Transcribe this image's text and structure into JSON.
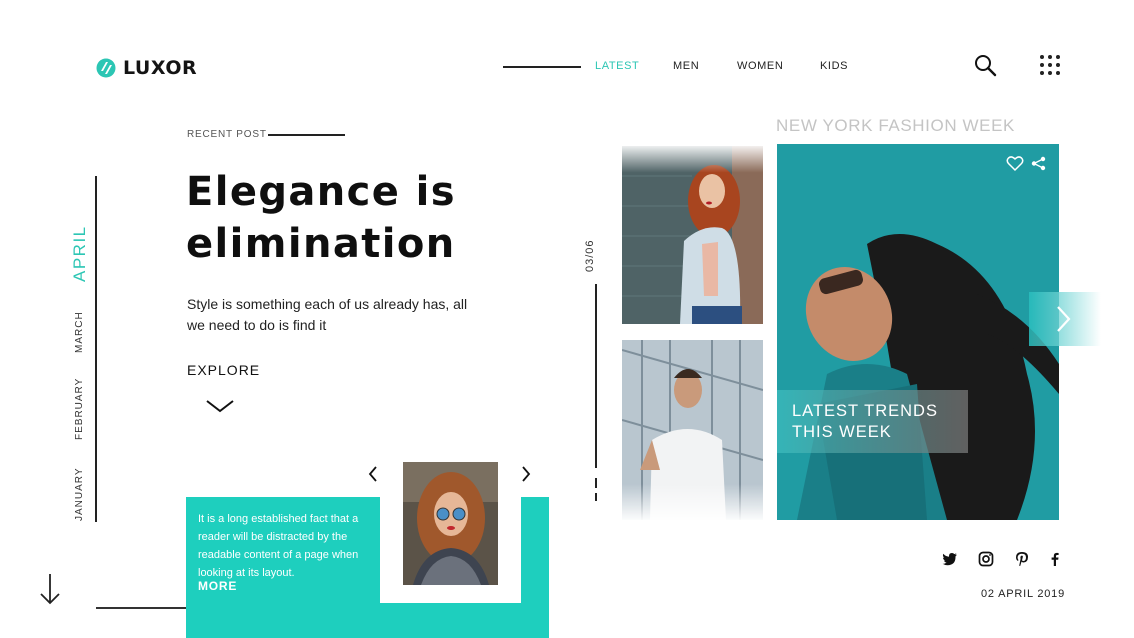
{
  "brand": {
    "name": "LUXOR",
    "accent_color": "#2cc6b4"
  },
  "nav": {
    "items": [
      {
        "label": "LATEST",
        "active": true
      },
      {
        "label": "MEN",
        "active": false
      },
      {
        "label": "WOMEN",
        "active": false
      },
      {
        "label": "KIDS",
        "active": false
      }
    ],
    "icons": [
      "search-icon",
      "grid-menu-icon"
    ]
  },
  "months": [
    "APRIL",
    "MARCH",
    "FEBRUARY",
    "JANUARY"
  ],
  "hero": {
    "label": "RECENT POST",
    "title_line1": "Elegance is",
    "title_line2": "elimination",
    "subtitle_line1": "Style is something each of us already has, all",
    "subtitle_line2": "we need to do is find it",
    "cta": "EXPLORE"
  },
  "card": {
    "color": "#1ecfbe",
    "lines": [
      "It is a long established fact that a",
      "reader will be distracted by the",
      "readable content of a page when",
      "looking at its layout."
    ],
    "more": "MORE"
  },
  "slider": {
    "counter": "03/06"
  },
  "gallery": {
    "heading": "NEW YORK FASHION WEEK",
    "feature_line1": "LATEST TRENDS",
    "feature_line2": "THIS WEEK",
    "feature_icons": [
      "heart-icon",
      "share-icon"
    ]
  },
  "social": [
    "twitter-icon",
    "instagram-icon",
    "pinterest-icon",
    "facebook-icon"
  ],
  "date": "02 APRIL 2019"
}
